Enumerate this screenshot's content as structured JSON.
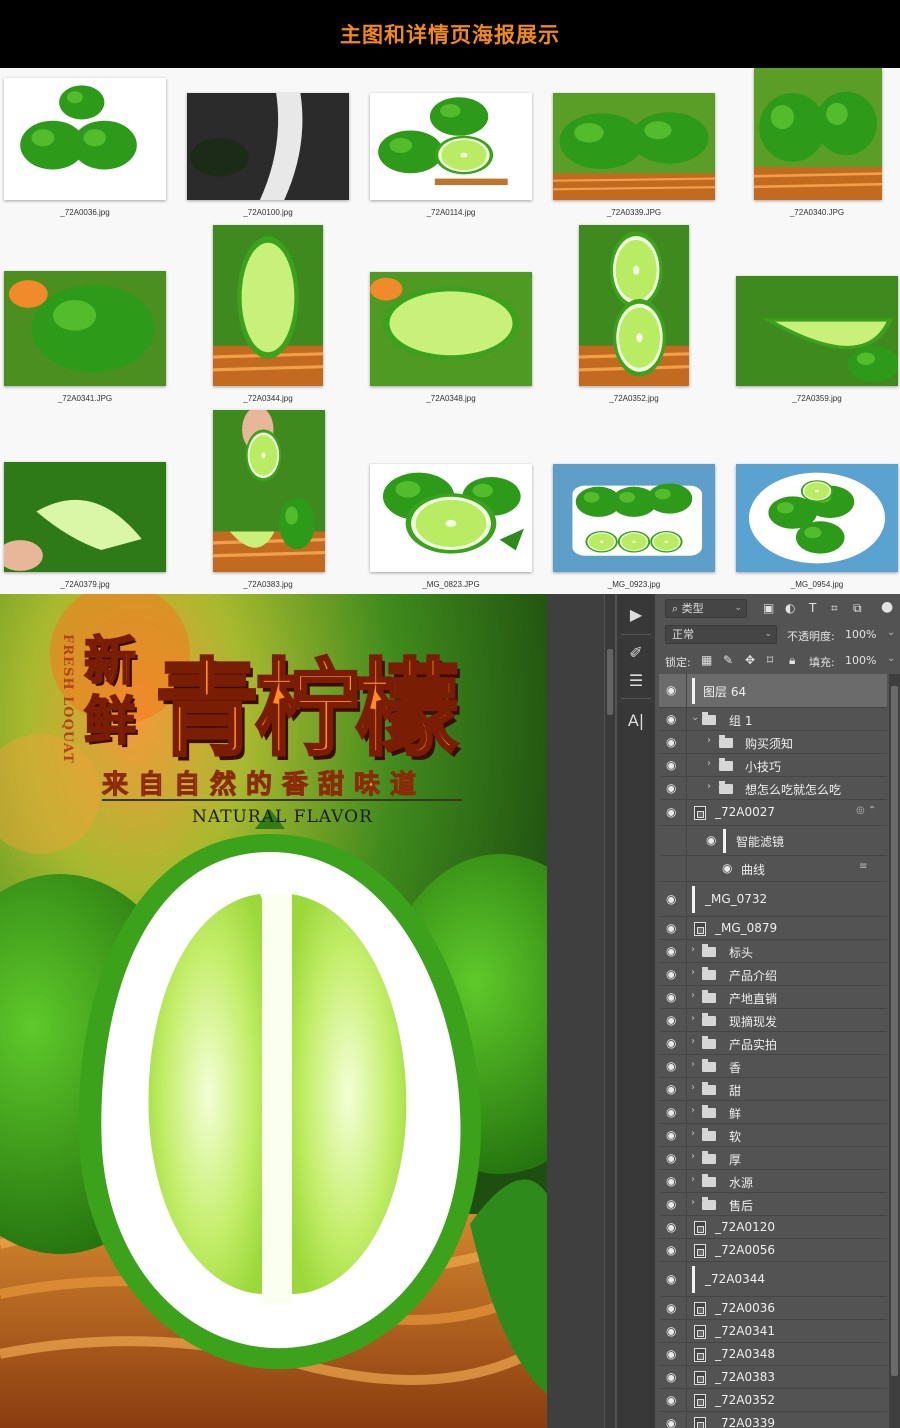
{
  "banner": {
    "title": "主图和详情页海报展示"
  },
  "gallery": {
    "thumbnails": [
      {
        "name": "_72A0036.jpg"
      },
      {
        "name": "_72A0100.jpg"
      },
      {
        "name": "_72A0114.jpg"
      },
      {
        "name": "_72A0339.JPG"
      },
      {
        "name": "_72A0340.JPG"
      },
      {
        "name": "_72A0341.JPG"
      },
      {
        "name": "_72A0344.jpg"
      },
      {
        "name": "_72A0348.jpg"
      },
      {
        "name": "_72A0352.jpg"
      },
      {
        "name": "_72A0359.jpg"
      },
      {
        "name": "_72A0379.jpg"
      },
      {
        "name": "_72A0383.jpg"
      },
      {
        "name": "_MG_0823.JPG"
      },
      {
        "name": "_MG_0923.jpg"
      },
      {
        "name": "_MG_0954.jpg"
      }
    ]
  },
  "poster": {
    "vertical_text": "FRESH LOQUAT",
    "title_small": "新鲜",
    "title_big": "青柠檬",
    "subtitle": "来自自然的香甜味道",
    "english": "NATURAL FLAVOR"
  },
  "photoshop": {
    "tools": [
      "play-icon",
      "brush-history-icon",
      "sliders-icon",
      "type-tool-icon"
    ],
    "tool_type_label": "A|",
    "filter": {
      "kind_label": "类型"
    },
    "blend": {
      "mode": "正常",
      "opacity_label": "不透明度:",
      "opacity": "100%"
    },
    "lock": {
      "label": "锁定:",
      "fill_label": "填充:",
      "fill": "100%"
    },
    "layers": [
      {
        "label": "图层 64",
        "type": "layer",
        "selected": true
      },
      {
        "label": "组 1",
        "type": "group-open"
      },
      {
        "label": "购买须知",
        "type": "subgroup"
      },
      {
        "label": "小技巧",
        "type": "subgroup"
      },
      {
        "label": "想怎么吃就怎么吃",
        "type": "subgroup"
      },
      {
        "label": "_72A0027",
        "type": "smart"
      },
      {
        "label": "智能滤镜",
        "type": "filter"
      },
      {
        "label": "曲线",
        "type": "filter-item"
      },
      {
        "label": "_MG_0732",
        "type": "image"
      },
      {
        "label": "_MG_0879",
        "type": "smart"
      },
      {
        "label": "标头",
        "type": "group"
      },
      {
        "label": "产品介绍",
        "type": "group"
      },
      {
        "label": "产地直销",
        "type": "group"
      },
      {
        "label": "现摘现发",
        "type": "group"
      },
      {
        "label": "产品实拍",
        "type": "group"
      },
      {
        "label": "香",
        "type": "group"
      },
      {
        "label": "甜",
        "type": "group"
      },
      {
        "label": "鲜",
        "type": "group"
      },
      {
        "label": "软",
        "type": "group"
      },
      {
        "label": "厚",
        "type": "group"
      },
      {
        "label": "水源",
        "type": "group"
      },
      {
        "label": "售后",
        "type": "group"
      },
      {
        "label": "_72A0120",
        "type": "smart"
      },
      {
        "label": "_72A0056",
        "type": "smart"
      },
      {
        "label": "_72A0344",
        "type": "image"
      },
      {
        "label": "_72A0036",
        "type": "smart"
      },
      {
        "label": "_72A0341",
        "type": "smart"
      },
      {
        "label": "_72A0348",
        "type": "smart"
      },
      {
        "label": "_72A0383",
        "type": "smart"
      },
      {
        "label": "_72A0352",
        "type": "smart"
      },
      {
        "label": "_72A0339",
        "type": "smart"
      }
    ]
  }
}
